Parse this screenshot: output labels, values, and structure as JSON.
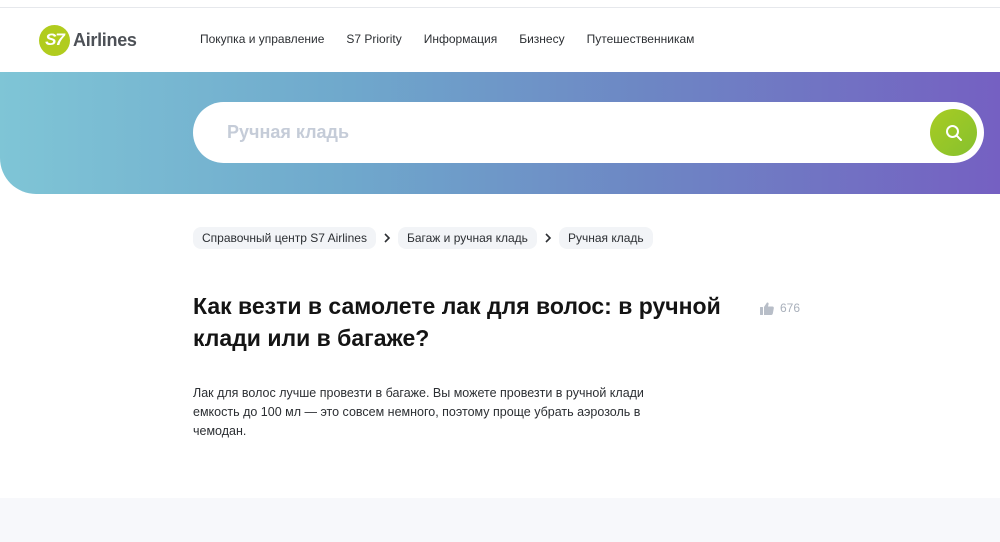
{
  "brand": {
    "logo_mark": "S7",
    "logo_text": "Airlines",
    "accent_color": "#b1cc1e"
  },
  "nav": {
    "items": [
      {
        "label": "Покупка и управление"
      },
      {
        "label": "S7 Priority"
      },
      {
        "label": "Информация"
      },
      {
        "label": "Бизнесу"
      },
      {
        "label": "Путешественникам"
      }
    ]
  },
  "search": {
    "placeholder": "Ручная кладь",
    "button_icon": "search-icon"
  },
  "breadcrumbs": [
    {
      "label": "Справочный центр S7 Airlines"
    },
    {
      "label": "Багаж и ручная кладь"
    },
    {
      "label": "Ручная кладь"
    }
  ],
  "article": {
    "title": "Как везти в самолете лак для волос: в ручной клади или в багаже?",
    "likes_icon": "thumbs-up-icon",
    "likes_count": "676",
    "body": "Лак для волос лучше провезти в багаже. Вы можете провезти в ручной клади емкость до 100 мл  — это совсем немного, поэтому проще убрать аэрозоль в чемодан."
  }
}
